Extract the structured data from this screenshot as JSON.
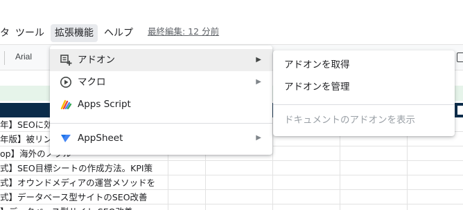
{
  "menubar": {
    "items": [
      {
        "label": "タ"
      },
      {
        "label": "ツール"
      },
      {
        "label": "拡張機能"
      },
      {
        "label": "ヘルプ"
      }
    ],
    "last_edit": "最終編集: 12 分前"
  },
  "toolbar": {
    "font_name": "Arial"
  },
  "grid": {
    "rows": [
      "年】SEOに効",
      "年版】被リン",
      "op】海外のノプル",
      "式】SEO目標シートの作成方法。KPI策",
      "式】オウンドメディアの運営メソッドを",
      "式】データベース型サイトのSEO改善",
      "】データベース型サイト SEO改善"
    ]
  },
  "extensions_menu": {
    "items": [
      {
        "icon": "addon-icon",
        "label": "アドオン",
        "has_submenu": true
      },
      {
        "icon": "macro-icon",
        "label": "マクロ",
        "has_submenu": true
      },
      {
        "icon": "apps-script-icon",
        "label": "Apps Script",
        "has_submenu": false
      },
      {
        "icon": "appsheet-icon",
        "label": "AppSheet",
        "has_submenu": true
      }
    ],
    "arrow": "▶"
  },
  "addons_submenu": {
    "items": [
      {
        "label": "アドオンを取得",
        "enabled": true
      },
      {
        "label": "アドオンを管理",
        "enabled": true
      },
      {
        "label": "ドキュメントのアドオンを表示",
        "enabled": false
      }
    ]
  },
  "colors": {
    "menu_highlight": "#eeeeee",
    "header_row": "#0b2c4a",
    "formula_area": "#e6f4ea",
    "appsheet_blue": "#4285f4"
  }
}
